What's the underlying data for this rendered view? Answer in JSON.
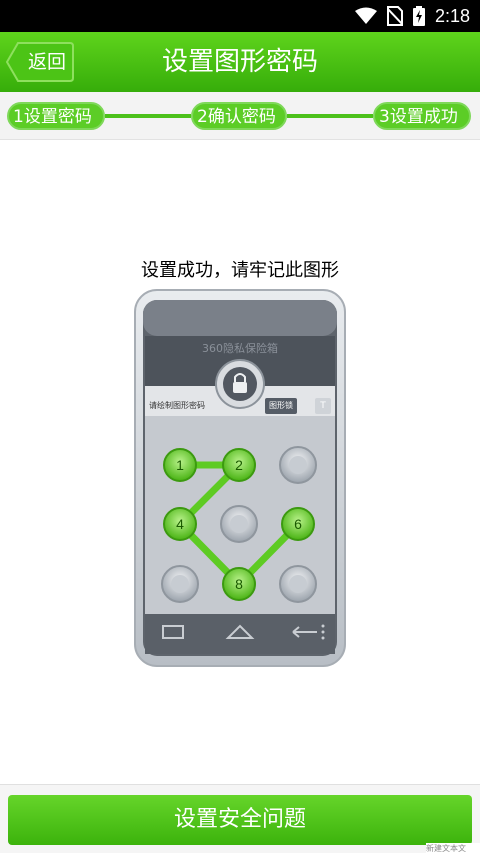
{
  "status_bar": {
    "time": "2:18",
    "icons": [
      "wifi-icon",
      "no-sim-icon",
      "battery-charging-icon"
    ]
  },
  "header": {
    "back_label": "返回",
    "title": "设置图形密码"
  },
  "steps": [
    {
      "label": "1设置密码"
    },
    {
      "label": "2确认密码"
    },
    {
      "label": "3设置成功"
    }
  ],
  "hint": "设置成功，请牢记此图形",
  "illustration": {
    "brand": "360隐私保险箱",
    "draw_hint": "请绘制图形密码",
    "pattern_lock_label": "图形锁",
    "text_mode_label": "T",
    "pattern_digits": [
      "1",
      "2",
      "4",
      "8",
      "6"
    ]
  },
  "bottom": {
    "button_label": "设置安全问题",
    "watermark": "新建文本文"
  },
  "colors": {
    "accent_green": "#3cb30c",
    "header_green": "#5fd41c",
    "step_green": "#5ccd26"
  }
}
